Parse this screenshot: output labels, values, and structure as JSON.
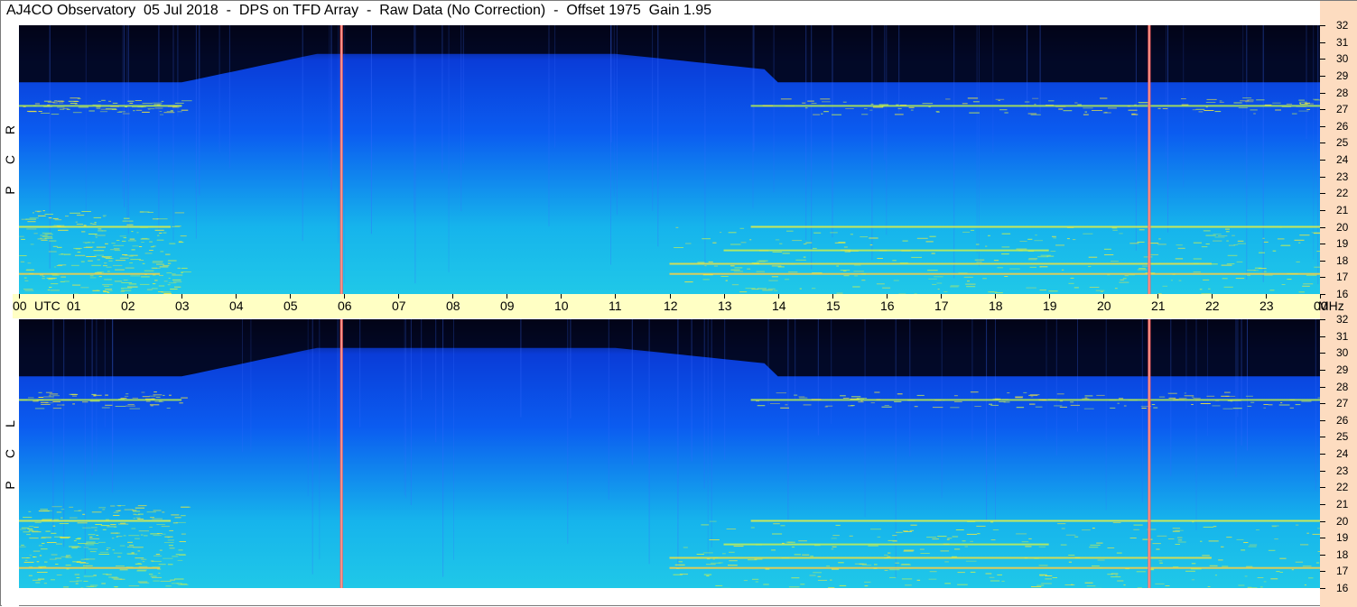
{
  "title": "AJ4CO Observatory  05 Jul 2018  -  DPS on TFD Array  -  Raw Data (No Correction)  -  Offset 1975  Gain 1.95",
  "panels": [
    {
      "id": "rcp",
      "letters": [
        "R",
        "C",
        "P"
      ]
    },
    {
      "id": "lcp",
      "letters": [
        "L",
        "C",
        "P"
      ]
    }
  ],
  "colors": {
    "background_dark": "#020418",
    "band_blue": "#0a3cd8",
    "mid_blue": "#0b5cf0",
    "cyan": "#16b4ec",
    "green_yellow": "#c8f050",
    "marker_line": "#ff5a5a",
    "time_bar": "#ffffc4",
    "mhz_strip": "#fddcc0"
  },
  "chart_data": {
    "type": "heatmap",
    "x_axis": {
      "unit_label": "UTC",
      "range_hours": [
        0,
        24
      ],
      "tick_labels": [
        "00",
        "01",
        "02",
        "03",
        "04",
        "05",
        "06",
        "07",
        "08",
        "09",
        "10",
        "11",
        "12",
        "13",
        "14",
        "15",
        "16",
        "17",
        "18",
        "19",
        "20",
        "21",
        "22",
        "23",
        "00"
      ],
      "first_label_suffix": "UTC"
    },
    "y_axis": {
      "unit_label": "MHz",
      "range": [
        16,
        32
      ],
      "tick_labels": [
        "32",
        "31",
        "30",
        "29",
        "28",
        "27",
        "26",
        "25",
        "24",
        "23",
        "22",
        "21",
        "20",
        "19",
        "18",
        "17",
        "16"
      ]
    },
    "vertical_markers_hours": [
      5.95,
      20.85
    ],
    "features": {
      "dark_cutoff_mhz_day": 30.3,
      "dark_cutoff_mhz_night": 28.6,
      "interference_bands_mhz": [
        17.2,
        17.8,
        18.6,
        20.0,
        27.2
      ]
    }
  }
}
